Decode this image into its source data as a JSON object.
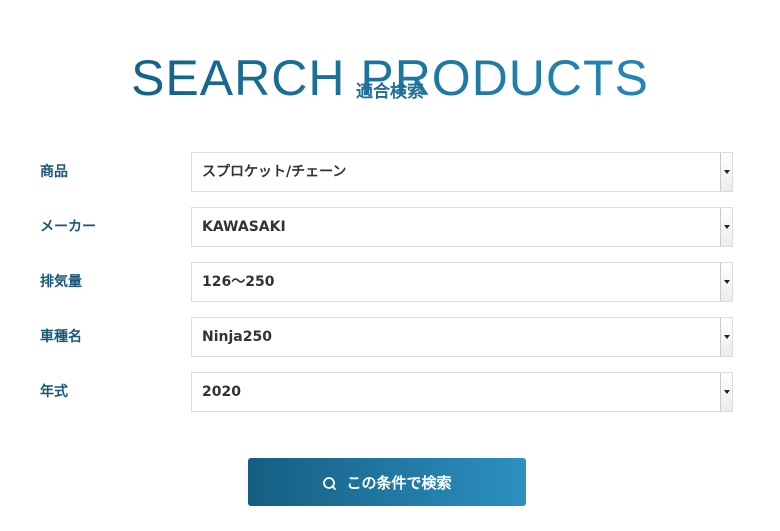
{
  "header": {
    "title": "SEARCH PRODUCTS",
    "subtitle": "適合検索"
  },
  "form": {
    "fields": [
      {
        "label": "商品",
        "value": "スプロケット/チェーン"
      },
      {
        "label": "メーカー",
        "value": "KAWASAKI"
      },
      {
        "label": "排気量",
        "value": "126〜250"
      },
      {
        "label": "車種名",
        "value": "Ninja250"
      },
      {
        "label": "年式",
        "value": "2020"
      }
    ],
    "submit_label": "この条件で検索",
    "submit_icon": "search-icon"
  },
  "colors": {
    "accent_dark": "#155e82",
    "accent_light": "#2c90c0",
    "label": "#1a5878"
  }
}
